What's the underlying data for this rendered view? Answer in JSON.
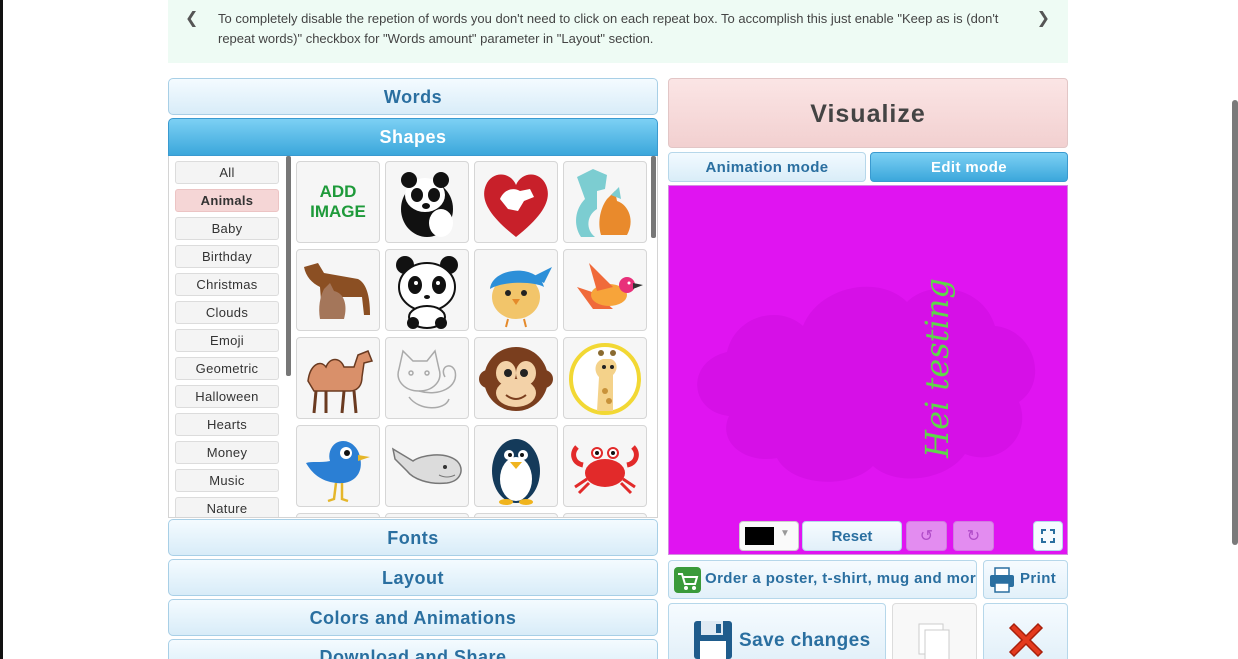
{
  "notice": {
    "text": "To completely disable the repetion of words you don't need to click on each repeat box. To accomplish this just enable \"Keep as is (don't repeat words)\" checkbox for \"Words amount\" parameter in \"Layout\" section.",
    "prev_icon": "chevron-left-icon",
    "next_icon": "chevron-right-icon"
  },
  "accordion": {
    "words": "Words",
    "shapes": "Shapes",
    "fonts": "Fonts",
    "layout": "Layout",
    "colors": "Colors and Animations",
    "download": "Download and Share"
  },
  "categories": [
    "All",
    "Animals",
    "Baby",
    "Birthday",
    "Christmas",
    "Clouds",
    "Emoji",
    "Geometric",
    "Halloween",
    "Hearts",
    "Money",
    "Music",
    "Nature"
  ],
  "selected_category": "Animals",
  "add_image": {
    "line1": "ADD",
    "line2": "IMAGE"
  },
  "shape_icons": [
    "panda-logo-icon",
    "heart-dog-cat-icon",
    "dog-cat-silhouette-icon",
    "dog-cat-brown-icon",
    "panda-cartoon-icon",
    "blue-bird-icon",
    "flying-bird-icon",
    "camel-icon",
    "cat-sketch-icon",
    "monkey-icon",
    "giraffe-circle-icon",
    "twitter-bird-icon",
    "whale-icon",
    "penguin-icon",
    "crab-icon"
  ],
  "visualize": "Visualize",
  "modes": {
    "animation": "Animation mode",
    "edit": "Edit mode"
  },
  "canvas": {
    "background": "#e014f1",
    "word": "Hei testing",
    "word_color": "#5fd64a"
  },
  "controls": {
    "color_swatch": "#000000",
    "reset": "Reset",
    "undo_icon": "undo-icon",
    "redo_icon": "redo-icon",
    "fullscreen_icon": "fullscreen-icon"
  },
  "actions": {
    "order": "Order a poster, t-shirt, mug and more",
    "print": "Print",
    "save": "Save changes"
  },
  "colors": {
    "accent": "#3ba7db",
    "accordion_text": "#2a6fa0",
    "selected_category": "#f5d6d6",
    "notice_bg": "#eefbf4"
  }
}
